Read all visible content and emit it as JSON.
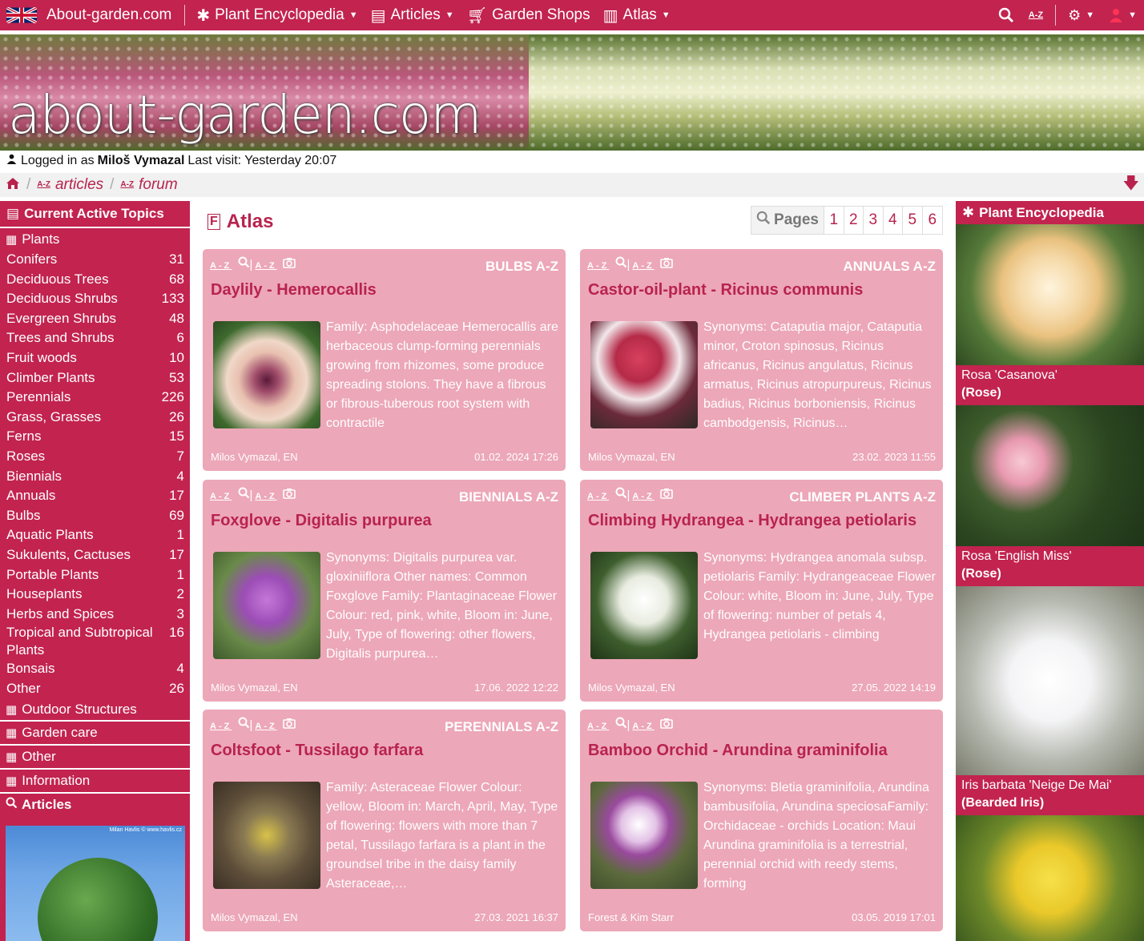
{
  "topnav": {
    "brand": "About-garden.com",
    "items": [
      {
        "label": "Plant Encyclopedia",
        "icon": "snowflake-icon",
        "caret": true
      },
      {
        "label": "Articles",
        "icon": "articles-icon",
        "caret": true
      },
      {
        "label": "Garden Shops",
        "icon": "cart-icon",
        "caret": false
      },
      {
        "label": "Atlas",
        "icon": "atlas-icon",
        "caret": true
      }
    ]
  },
  "banner": {
    "logo_text": "about-garden.com"
  },
  "login": {
    "prefix": "Logged in as",
    "user": "Miloš Vymazal",
    "last_visit": "Last visit: Yesterday 20:07"
  },
  "breadcrumb": {
    "items": [
      "articles",
      "forum"
    ],
    "az": "A-Z"
  },
  "left_sidebar": {
    "header": "Current Active Topics",
    "plants_label": "Plants",
    "topics": [
      {
        "label": "Conifers",
        "count": "31"
      },
      {
        "label": "Deciduous Trees",
        "count": "68"
      },
      {
        "label": "Deciduous Shrubs",
        "count": "133"
      },
      {
        "label": "Evergreen Shrubs",
        "count": "48"
      },
      {
        "label": "Trees and Shrubs",
        "count": "6"
      },
      {
        "label": "Fruit woods",
        "count": "10"
      },
      {
        "label": "Climber Plants",
        "count": "53"
      },
      {
        "label": "Perennials",
        "count": "226"
      },
      {
        "label": "Grass, Grasses",
        "count": "26"
      },
      {
        "label": "Ferns",
        "count": "15"
      },
      {
        "label": "Roses",
        "count": "7"
      },
      {
        "label": "Biennials",
        "count": "4"
      },
      {
        "label": "Annuals",
        "count": "17"
      },
      {
        "label": "Bulbs",
        "count": "69"
      },
      {
        "label": "Aquatic Plants",
        "count": "1"
      },
      {
        "label": "Sukulents, Cactuses",
        "count": "17"
      },
      {
        "label": "Portable Plants",
        "count": "1"
      },
      {
        "label": "Houseplants",
        "count": "2"
      },
      {
        "label": "Herbs and Spices",
        "count": "3"
      },
      {
        "label": "Tropical and Subtropical Plants",
        "count": "16"
      },
      {
        "label": "Bonsais",
        "count": "4"
      },
      {
        "label": "Other",
        "count": "26"
      }
    ],
    "sections": [
      "Outdoor Structures",
      "Garden care",
      "Other",
      "Information"
    ],
    "articles_label": "Articles",
    "image_credit": "Milan Havlis © www.havlis.cz"
  },
  "main": {
    "title": "Atlas",
    "pager_label": "Pages",
    "pages": [
      "1",
      "2",
      "3",
      "4",
      "5",
      "6"
    ],
    "cards": [
      {
        "category": "BULBS A-Z",
        "title": "Daylily - Hemerocallis",
        "desc": "Family: Asphodelaceae Hemerocallis are herbaceous clump-forming perennials growing from rhizomes, some produce spreading stolons. They have a fibrous or fibrous-tuberous root system with contractile",
        "author": "Milos Vymazal, EN",
        "date": "01.02. 2024 17:26"
      },
      {
        "category": "ANNUALS A-Z",
        "title": "Castor-oil-plant - Ricinus communis",
        "desc": "Synonyms: Cataputia major, Cataputia minor, Croton spinosus, Ricinus africanus, Ricinus angulatus, Ricinus armatus, Ricinus atropurpureus, Ricinus badius, Ricinus borboniensis, Ricinus cambodgensis, Ricinus…",
        "author": "Milos Vymazal, EN",
        "date": "23.02. 2023 11:55"
      },
      {
        "category": "BIENNIALS A-Z",
        "title": "Foxglove - Digitalis purpurea",
        "desc": "Synonyms: Digitalis purpurea var. gloxiniiflora Other names: Common Foxglove Family: Plantaginaceae Flower Colour: red, pink, white, Bloom in: June, July, Type of flowering: other flowers, Digitalis purpurea…",
        "author": "Milos Vymazal, EN",
        "date": "17.06. 2022 12:22"
      },
      {
        "category": "CLIMBER PLANTS A-Z",
        "title": "Climbing Hydrangea - Hydrangea petiolaris",
        "desc": "Synonyms: Hydrangea anomala subsp. petiolaris Family: Hydrangeaceae Flower Colour: white, Bloom in: June, July, Type of flowering: number of petals 4, Hydrangea petiolaris - climbing",
        "author": "Milos Vymazal, EN",
        "date": "27.05. 2022 14:19"
      },
      {
        "category": "PERENNIALS A-Z",
        "title": "Coltsfoot - Tussilago farfara",
        "desc": "Family: Asteraceae Flower Colour: yellow, Bloom in: March, April, May, Type of flowering: flowers with more than 7 petal, Tussilago farfara is a plant in the groundsel tribe in the daisy family Asteraceae,…",
        "author": "Milos Vymazal, EN",
        "date": "27.03. 2021 16:37"
      },
      {
        "category": "",
        "title": "Bamboo Orchid - Arundina graminifolia",
        "desc": "Synonyms: Bletia graminifolia, Arundina bambusifolia, Arundina speciosaFamily: Orchidaceae - orchids Location: Maui Arundina graminifolia is a terrestrial, perennial orchid with reedy stems, forming",
        "author": "Forest & Kim Starr",
        "date": "03.05. 2019 17:01"
      }
    ]
  },
  "right_sidebar": {
    "header": "Plant Encyclopedia",
    "items": [
      {
        "name": "Rosa 'Casanova'",
        "sub": "(Rose)"
      },
      {
        "name": "Rosa 'English Miss'",
        "sub": "(Rose)"
      },
      {
        "name": "Iris barbata 'Neige De Mai'",
        "sub": "(Bearded Iris)"
      }
    ]
  }
}
